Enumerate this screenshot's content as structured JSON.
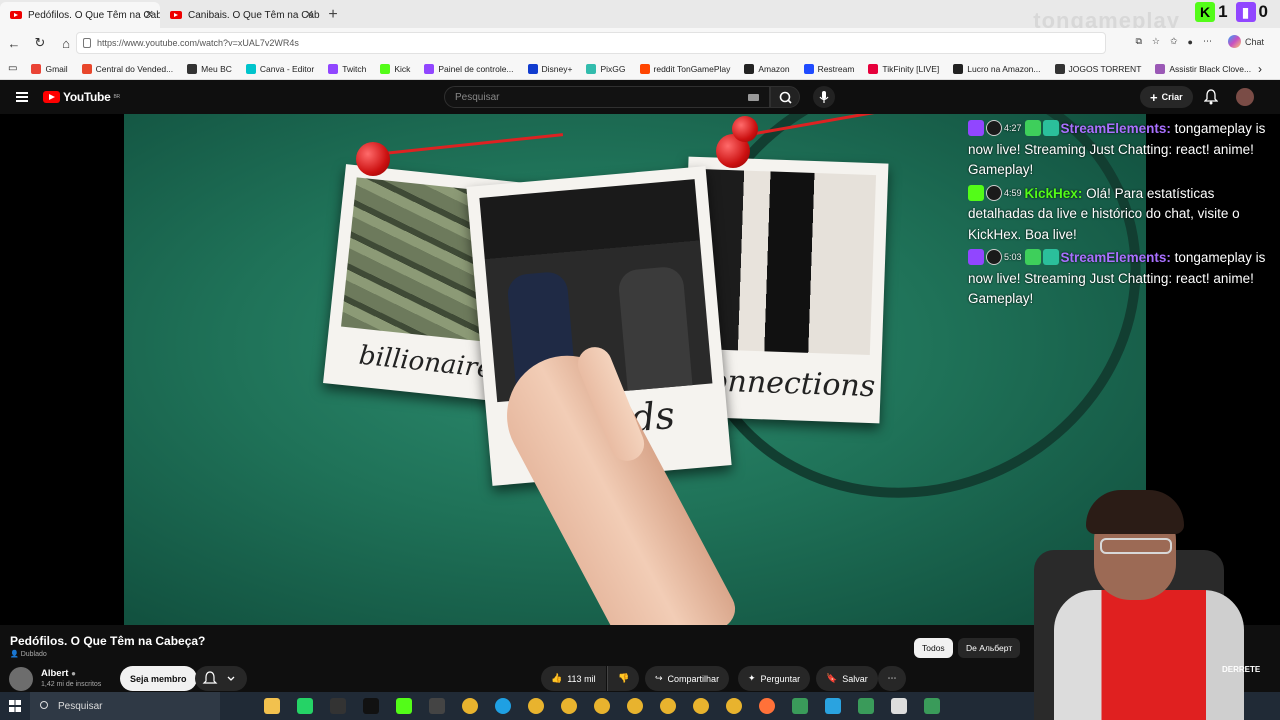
{
  "browser": {
    "tabs": [
      {
        "title": "Pedófilos. O Que Têm na Cabeça?",
        "active": true
      },
      {
        "title": "Canibais. O Que Têm na Cabeça?",
        "active": false
      }
    ],
    "overlay_counts": {
      "kick": "1",
      "twitch": "0"
    },
    "watermark": "tongameplay",
    "url": "https://www.youtube.com/watch?v=xUAL7v2WR4s",
    "chat_label": "Chat",
    "bookmarks": [
      {
        "label": "Gmail",
        "color": "#ea4335"
      },
      {
        "label": "Central do Vended...",
        "color": "#e8462b"
      },
      {
        "label": "Meu BC",
        "color": "#333333"
      },
      {
        "label": "Canva - Editor",
        "color": "#00c4cc"
      },
      {
        "label": "Twitch",
        "color": "#9146ff"
      },
      {
        "label": "Kick",
        "color": "#53fc18"
      },
      {
        "label": "Painel de controle...",
        "color": "#9146ff"
      },
      {
        "label": "Disney+",
        "color": "#113ccf"
      },
      {
        "label": "PixGG",
        "color": "#32bcad"
      },
      {
        "label": "reddit TonGamePlay",
        "color": "#ff4500"
      },
      {
        "label": "Amazon",
        "color": "#222222"
      },
      {
        "label": "Restream",
        "color": "#1f4bff"
      },
      {
        "label": "TikFinity [LIVE]",
        "color": "#e6003b"
      },
      {
        "label": "Lucro na Amazon...",
        "color": "#222222"
      },
      {
        "label": "JOGOS TORRENT",
        "color": "#333333"
      },
      {
        "label": "Assistir Black Clove...",
        "color": "#9b59b6"
      }
    ]
  },
  "youtube": {
    "logo": "YouTube",
    "region": "BR",
    "search_placeholder": "Pesquisar",
    "create_label": "Criar"
  },
  "video": {
    "captions": [
      "billionaire",
      "friends",
      "connections"
    ],
    "title": "Pedófilos. O Que Têm na Cabeça?",
    "dubbed": "Dublado",
    "channel": "Albert",
    "subscribers": "1,42 mi de inscritos",
    "member_label": "Seja membro",
    "likes": "113 mil",
    "share_label": "Compartilhar",
    "ask_label": "Perguntar",
    "save_label": "Salvar",
    "chips": [
      "Todos",
      "De Альберт"
    ],
    "side_text": "DERRETE"
  },
  "chat": [
    {
      "time": "4:27",
      "user": "StreamElements:",
      "text": "tongameplay is now live! Streaming Just Chatting: react! anime! Gameplay!",
      "platform": "twitch",
      "user_color": "#a970ff"
    },
    {
      "time": "4:59",
      "user": "KickHex:",
      "text": "Olá! Para estatísticas detalhadas da live e histórico do chat, visite o KickHex. Boa live!",
      "platform": "kick",
      "user_color": "#53fc18"
    },
    {
      "time": "5:03",
      "user": "StreamElements:",
      "text": "tongameplay is now live! Streaming Just Chatting: react! anime! Gameplay!",
      "platform": "twitch",
      "user_color": "#a970ff"
    }
  ],
  "taskbar": {
    "search_placeholder": "Pesquisar",
    "icons": [
      "explorer-icon",
      "whatsapp-icon",
      "terminal-icon",
      "tiktok-icon",
      "play-icon",
      "obs-icon",
      "chrome-icon",
      "edge-icon",
      "chrome-icon",
      "chrome-icon",
      "chrome-icon",
      "chrome-icon",
      "chrome-icon",
      "chrome-icon",
      "chrome-icon",
      "firefox-icon",
      "app-icon",
      "telegram-icon",
      "app-icon",
      "pen-icon",
      "app-icon"
    ]
  }
}
